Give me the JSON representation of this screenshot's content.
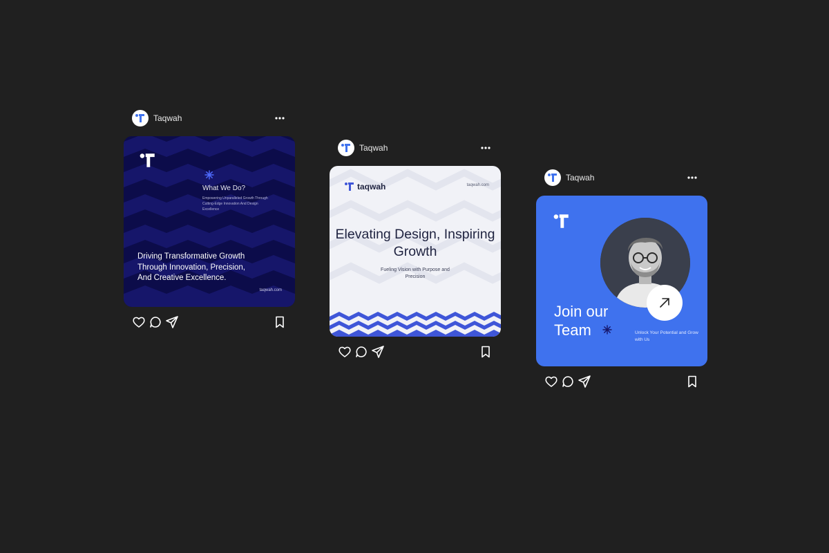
{
  "posts": [
    {
      "username": "Taqwah",
      "card": {
        "question": "What We Do?",
        "description": "Empowering Unparalleled Growth Through Cutting-Edge Innovation And Design Excellence",
        "headline": "Driving Transformative Growth Through Innovation, Precision, And Creative Excellence.",
        "url": "taqwah.com",
        "background": "#0c0c4a"
      }
    },
    {
      "username": "Taqwah",
      "card": {
        "brand": "taqwah",
        "url": "taqwah.com",
        "title": "Elevating Design, Inspiring Growth",
        "subtitle": "Fueling Vision with Purpose and Precision",
        "background": "#f1f2f7"
      }
    },
    {
      "username": "Taqwah",
      "card": {
        "title": "Join our Team",
        "subtitle": "Unlock Your Potential and Grow with Us",
        "background": "#3f72ee"
      }
    }
  ],
  "icons": {
    "like": "heart-icon",
    "comment": "comment-icon",
    "share": "send-icon",
    "save": "bookmark-icon",
    "more": "more-options-icon"
  },
  "colors": {
    "page_background": "#202020",
    "brand_blue": "#3f72ee",
    "navy": "#0c0c4a"
  }
}
